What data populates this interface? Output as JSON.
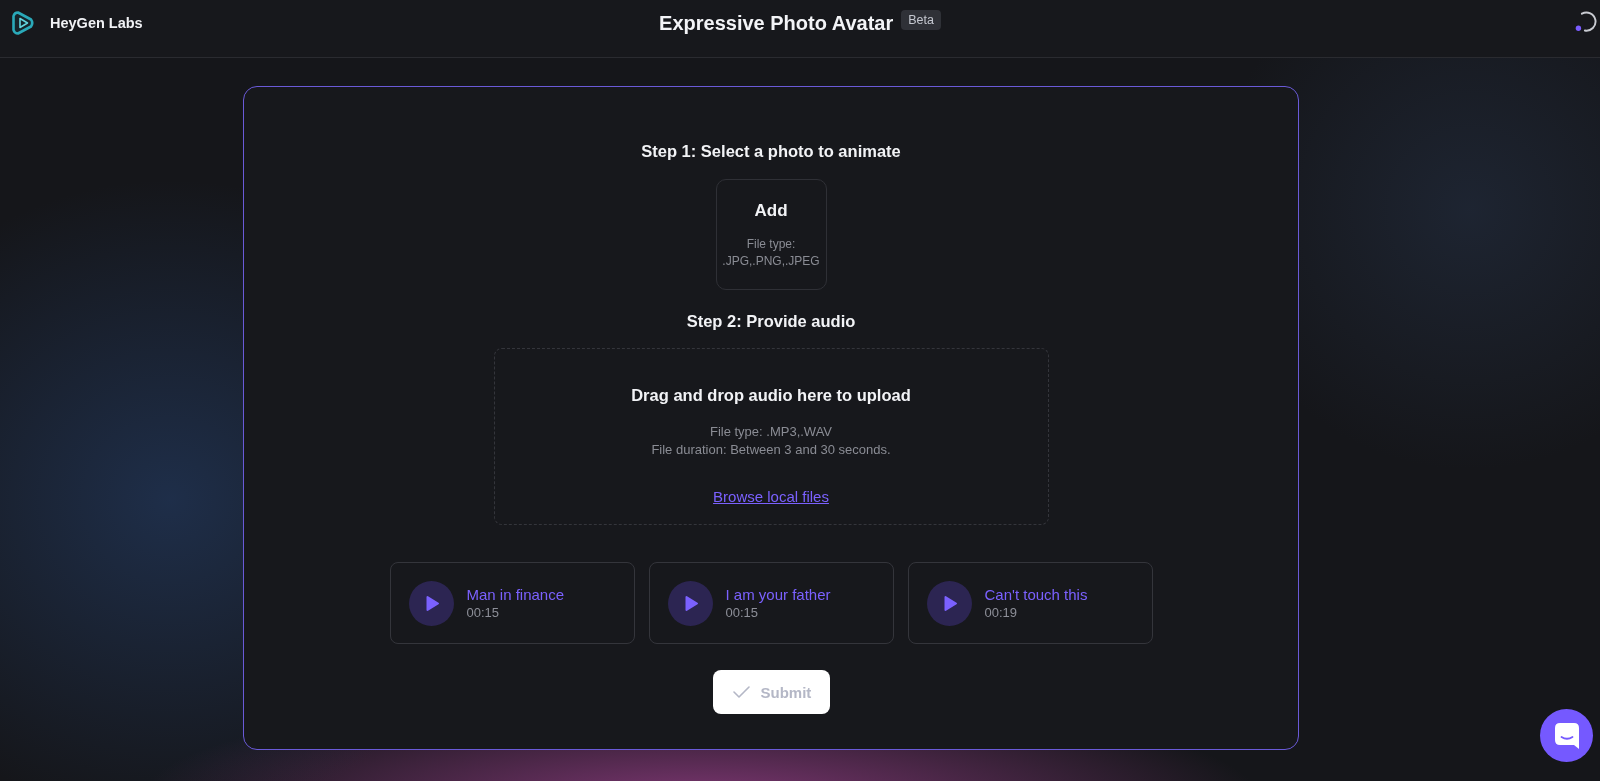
{
  "header": {
    "brand": "HeyGen Labs",
    "title": "Expressive Photo Avatar",
    "badge": "Beta"
  },
  "step_1": {
    "heading": "Step 1: Select a photo to animate",
    "upload": {
      "label": "Add",
      "hint": "File type: .JPG,.PNG,.JPEG"
    }
  },
  "step_2": {
    "heading": "Step 2: Provide audio",
    "dropzone": {
      "title": "Drag and drop audio here to upload",
      "hints": [
        "File type: .MP3,.WAV",
        "File duration: Between 3 and 30 seconds."
      ],
      "link": "Browse local files"
    }
  },
  "samples": [
    {
      "title": "Man in finance",
      "duration": "00:15"
    },
    {
      "title": "I am your father",
      "duration": "00:15"
    },
    {
      "title": "Can't touch this",
      "duration": "00:19"
    }
  ],
  "submit": {
    "label": "Submit",
    "disabled": true
  }
}
